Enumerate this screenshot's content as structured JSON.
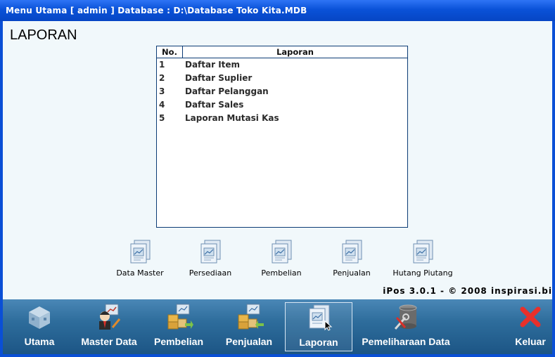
{
  "window": {
    "title": "Menu Utama [ admin ] Database : D:\\Database Toko Kita.MDB"
  },
  "page": {
    "title": "LAPORAN"
  },
  "table": {
    "headers": {
      "no": "No.",
      "laporan": "Laporan"
    },
    "rows": [
      {
        "no": "1",
        "label": "Daftar Item"
      },
      {
        "no": "2",
        "label": "Daftar Suplier"
      },
      {
        "no": "3",
        "label": "Daftar Pelanggan"
      },
      {
        "no": "4",
        "label": "Daftar Sales"
      },
      {
        "no": "5",
        "label": "Laporan Mutasi Kas"
      }
    ]
  },
  "categories": [
    {
      "label": "Data Master",
      "icon": "report-doc-icon"
    },
    {
      "label": "Persediaan",
      "icon": "report-doc-icon"
    },
    {
      "label": "Pembelian",
      "icon": "report-doc-icon"
    },
    {
      "label": "Penjualan",
      "icon": "report-doc-icon"
    },
    {
      "label": "Hutang Piutang",
      "icon": "report-doc-icon"
    }
  ],
  "version": "iPos 3.0.1 - © 2008 inspirasi.bi",
  "toolbar": {
    "utama": "Utama",
    "master_data": "Master Data",
    "pembelian": "Pembelian",
    "penjualan": "Penjualan",
    "laporan": "Laporan",
    "pemeliharaan": "Pemeliharaan Data",
    "keluar": "Keluar"
  },
  "colors": {
    "titlebar": "#0a52d8",
    "client": "#f1f8fb",
    "toolbar": "#2e6d9c",
    "close": "#e8302a"
  }
}
